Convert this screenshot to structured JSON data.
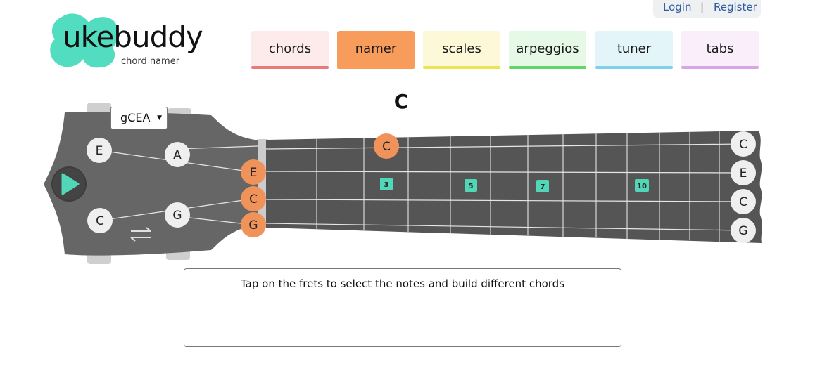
{
  "auth": {
    "login": "Login",
    "separator": "|",
    "register": "Register"
  },
  "logo": {
    "part1": "uke",
    "part2": "buddy",
    "subtitle": "chord namer"
  },
  "nav": [
    {
      "label": "chords",
      "bg": "#fdeaea",
      "bar": "#e57c7a",
      "active": false
    },
    {
      "label": "namer",
      "bg": "#f89c5b",
      "bar": "#f89c5b",
      "active": true
    },
    {
      "label": "scales",
      "bg": "#fdf8d8",
      "bar": "#ece254",
      "active": false
    },
    {
      "label": "arpeggios",
      "bg": "#e6f8e6",
      "bar": "#64d56d",
      "active": false
    },
    {
      "label": "tuner",
      "bg": "#e4f5fa",
      "bar": "#7fd1e8",
      "active": false
    },
    {
      "label": "tabs",
      "bg": "#faeefa",
      "bar": "#d7a6e6",
      "active": false
    }
  ],
  "chord": {
    "name": "C"
  },
  "tuning": {
    "value": "gCEA"
  },
  "headstock": {
    "peg_notes": [
      "E",
      "A",
      "C",
      "G"
    ],
    "nut_notes": [
      "E",
      "C",
      "G"
    ],
    "icons": [
      "play-icon",
      "swap-arrows-icon"
    ]
  },
  "fretboard": {
    "selected_note": "C",
    "fret_markers": [
      "3",
      "5",
      "7",
      "10"
    ],
    "open_strings": [
      "C",
      "E",
      "C",
      "G"
    ]
  },
  "info": {
    "message": "Tap on the frets to select the notes and build different chords"
  },
  "colors": {
    "accent": "#f0935a",
    "marker": "#52d6b8",
    "board": "#555555",
    "logo": "#52ddc0"
  }
}
